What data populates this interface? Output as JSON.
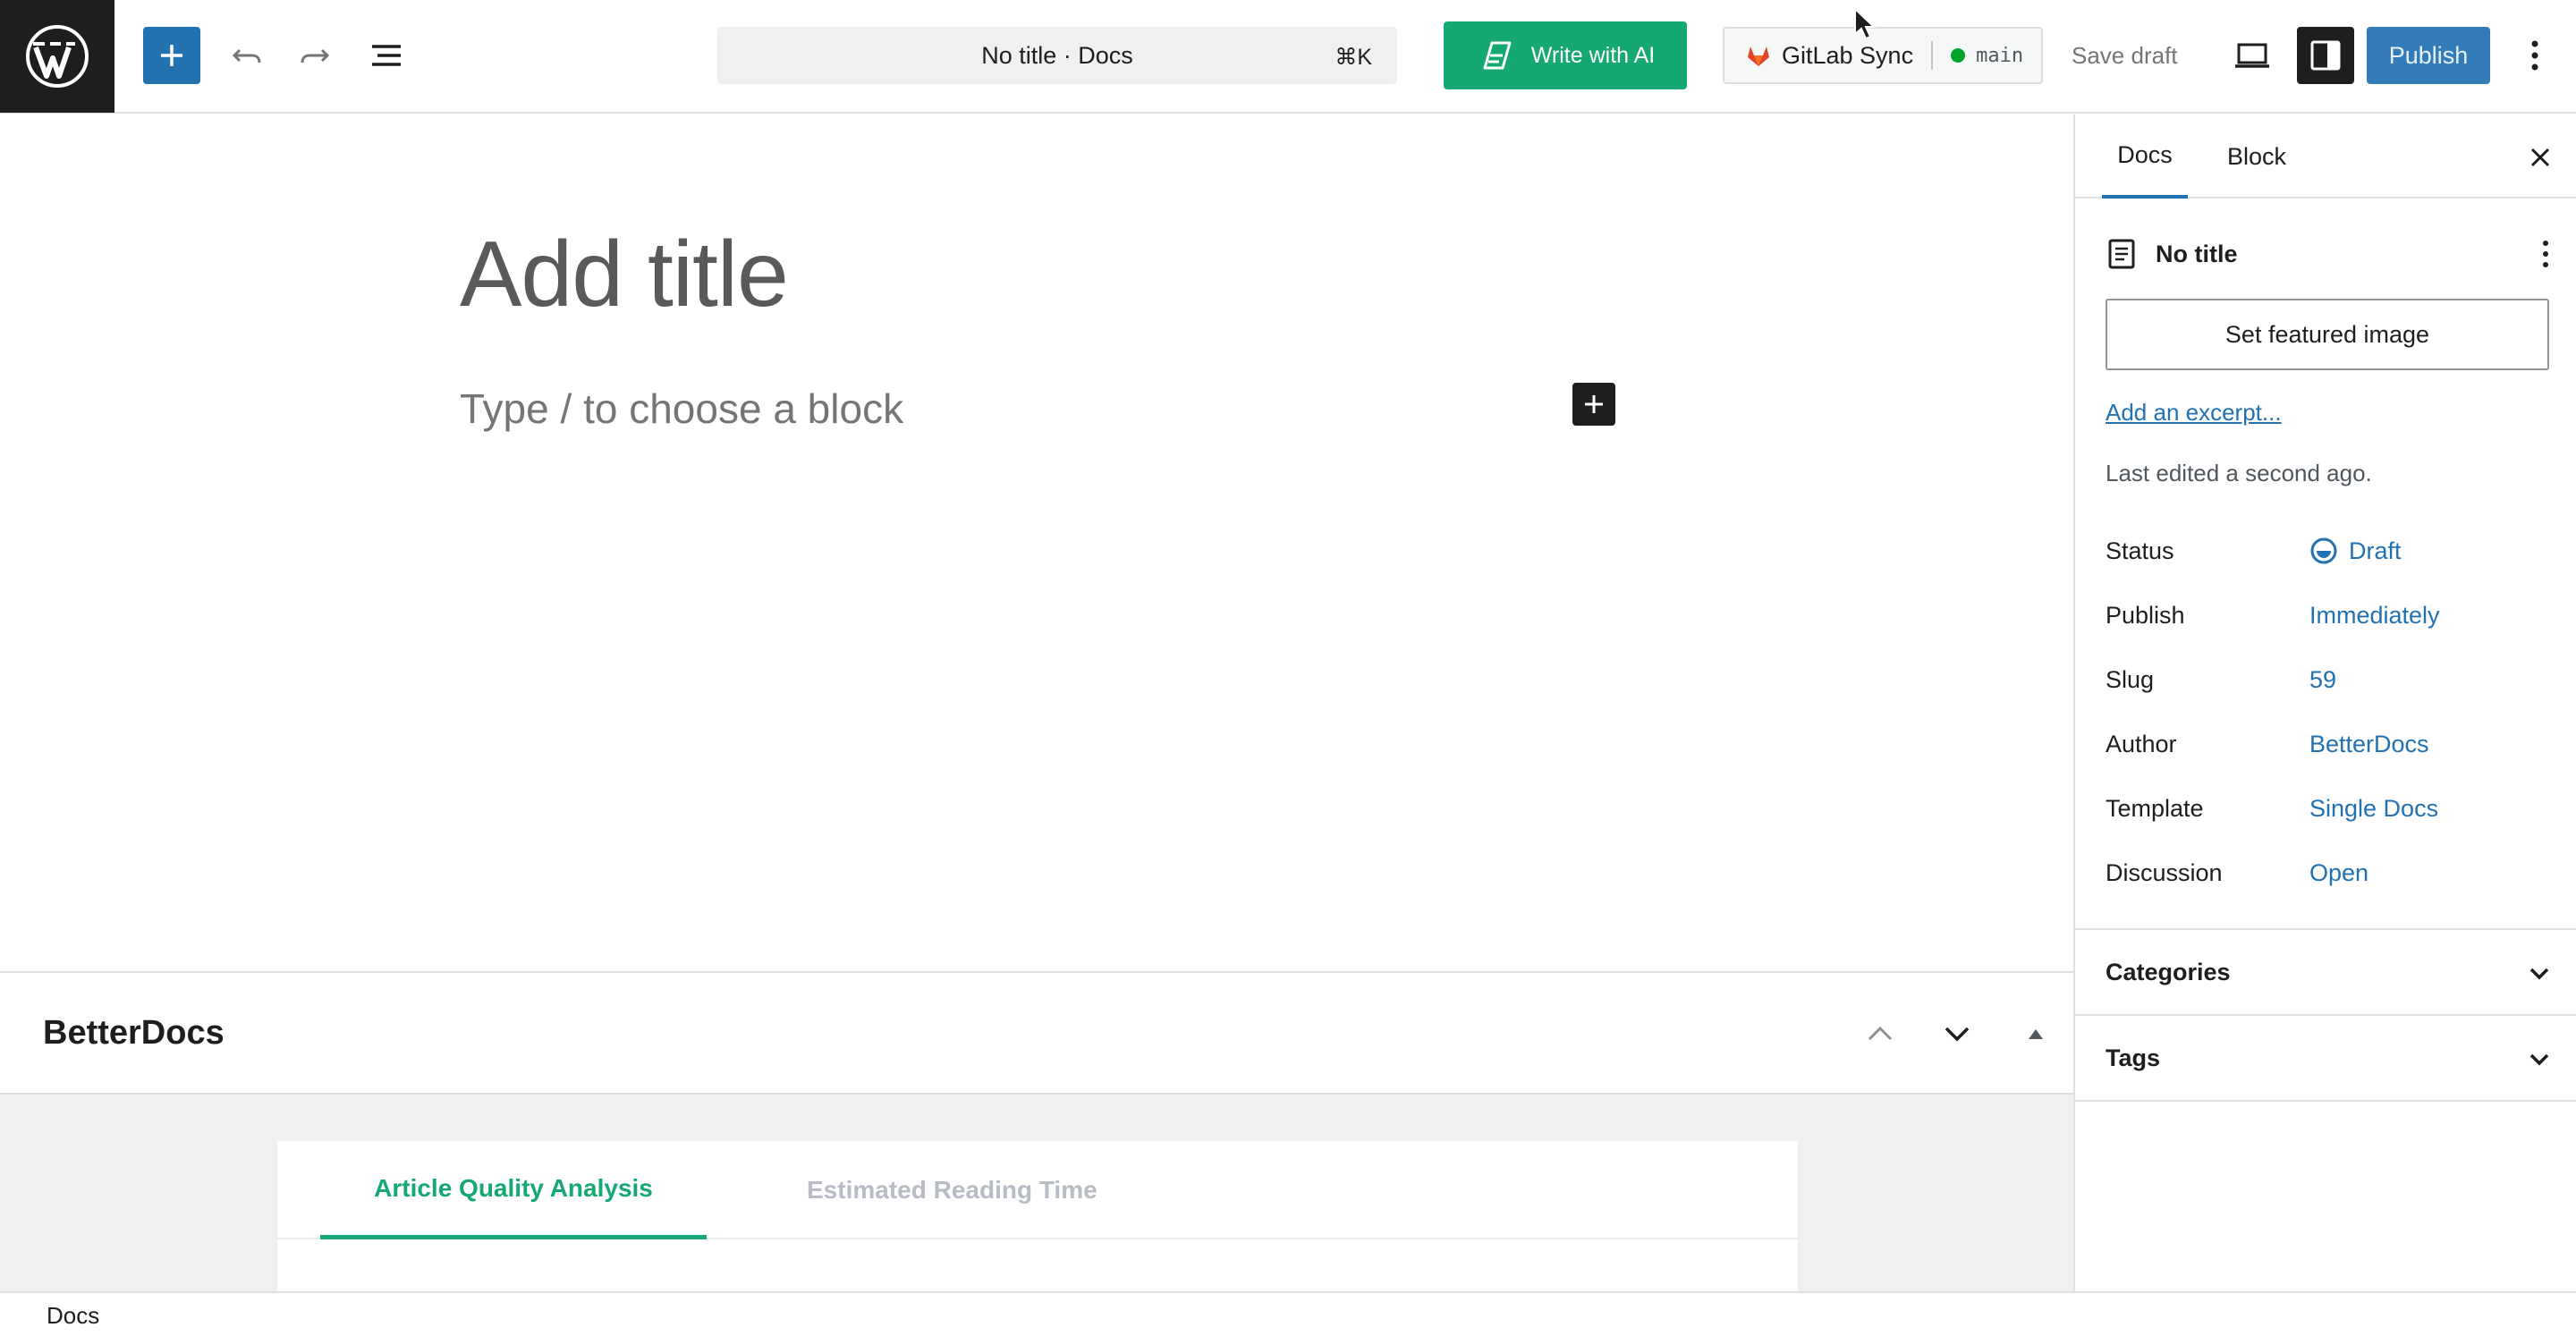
{
  "topbar": {
    "command_label": "No title · Docs",
    "command_shortcut": "⌘K",
    "write_ai_label": "Write with AI",
    "gitlab_label": "GitLab Sync",
    "gitlab_branch": "main",
    "save_draft_label": "Save draft",
    "publish_label": "Publish"
  },
  "editor": {
    "title_placeholder": "Add title",
    "block_placeholder": "Type / to choose a block"
  },
  "metabox": {
    "title": "BetterDocs",
    "tabs": [
      {
        "label": "Article Quality Analysis",
        "active": true
      },
      {
        "label": "Estimated Reading Time",
        "active": false
      }
    ]
  },
  "sidebar": {
    "tabs": [
      {
        "label": "Docs",
        "active": true
      },
      {
        "label": "Block",
        "active": false
      }
    ],
    "post_title": "No title",
    "featured_image_label": "Set featured image",
    "excerpt_label": "Add an excerpt...",
    "last_edited": "Last edited a second ago.",
    "properties": [
      {
        "key": "Status",
        "value": "Draft"
      },
      {
        "key": "Publish",
        "value": "Immediately"
      },
      {
        "key": "Slug",
        "value": "59"
      },
      {
        "key": "Author",
        "value": "BetterDocs"
      },
      {
        "key": "Template",
        "value": "Single Docs"
      },
      {
        "key": "Discussion",
        "value": "Open"
      }
    ],
    "sections": [
      {
        "label": "Categories"
      },
      {
        "label": "Tags"
      }
    ]
  },
  "footer": {
    "breadcrumb": "Docs"
  },
  "colors": {
    "accent": "#2271b1",
    "ai_green": "#16a872",
    "dark": "#1e1e1e"
  }
}
